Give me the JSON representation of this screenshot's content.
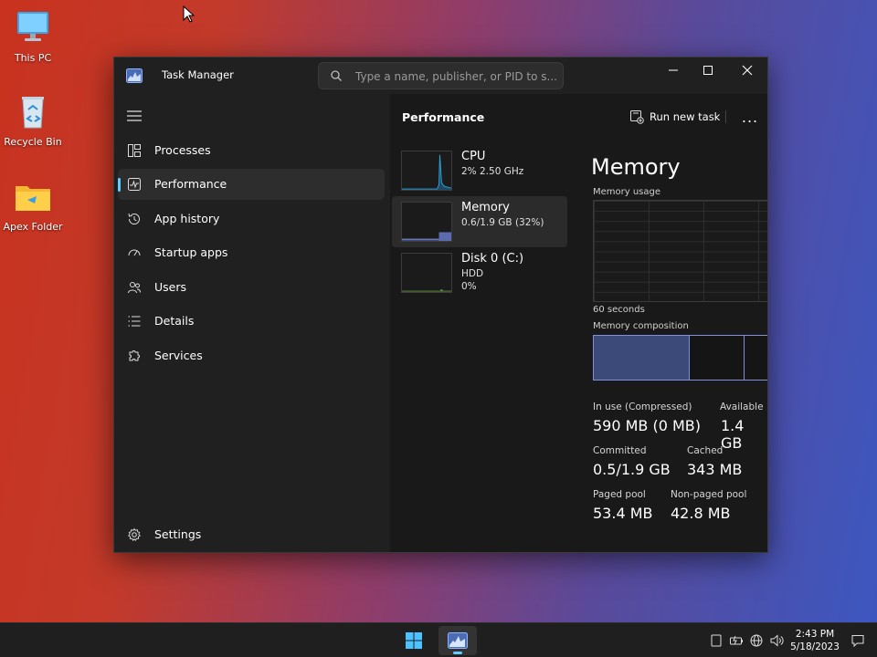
{
  "desktop": {
    "icons": [
      {
        "label": "This PC"
      },
      {
        "label": "Recycle Bin"
      },
      {
        "label": "Apex Folder"
      }
    ]
  },
  "window": {
    "title": "Task Manager",
    "search_placeholder": "Type a name, publisher, or PID to s..."
  },
  "nav": {
    "items": [
      {
        "label": "Processes"
      },
      {
        "label": "Performance"
      },
      {
        "label": "App history"
      },
      {
        "label": "Startup apps"
      },
      {
        "label": "Users"
      },
      {
        "label": "Details"
      },
      {
        "label": "Services"
      }
    ],
    "settings_label": "Settings",
    "active": "Performance"
  },
  "main": {
    "title": "Performance",
    "run_new_task": "Run new task",
    "more": "..."
  },
  "resources": [
    {
      "name": "CPU",
      "value": "2%  2.50 GHz",
      "value2": ""
    },
    {
      "name": "Memory",
      "value": "0.6/1.9 GB (32%)",
      "value2": ""
    },
    {
      "name": "Disk 0 (C:)",
      "value": "HDD",
      "value2": "0%"
    }
  ],
  "memory": {
    "title": "Memory",
    "usage_label": "Memory usage",
    "time_label": "60 seconds",
    "composition_label": "Memory composition",
    "composition": {
      "in_use_fraction": 0.53,
      "modified_fraction": 0.3
    },
    "stats": {
      "in_use_label": "In use (Compressed)",
      "in_use_value": "590 MB (0 MB)",
      "available_label": "Available",
      "available_value": "1.4 GB",
      "committed_label": "Committed",
      "committed_value": "0.5/1.9 GB",
      "cached_label": "Cached",
      "cached_value": "343 MB",
      "paged_label": "Paged pool",
      "paged_value": "53.4 MB",
      "nonpaged_label": "Non-paged pool",
      "nonpaged_value": "42.8 MB"
    }
  },
  "taskbar": {
    "time": "2:43 PM",
    "date": "5/18/2023"
  },
  "colors": {
    "accent": "#60cdff",
    "memory_graph": "#8190d6",
    "cpu_graph": "#2ea2d8",
    "window_bg": "#202020",
    "panel_bg": "#191919"
  }
}
